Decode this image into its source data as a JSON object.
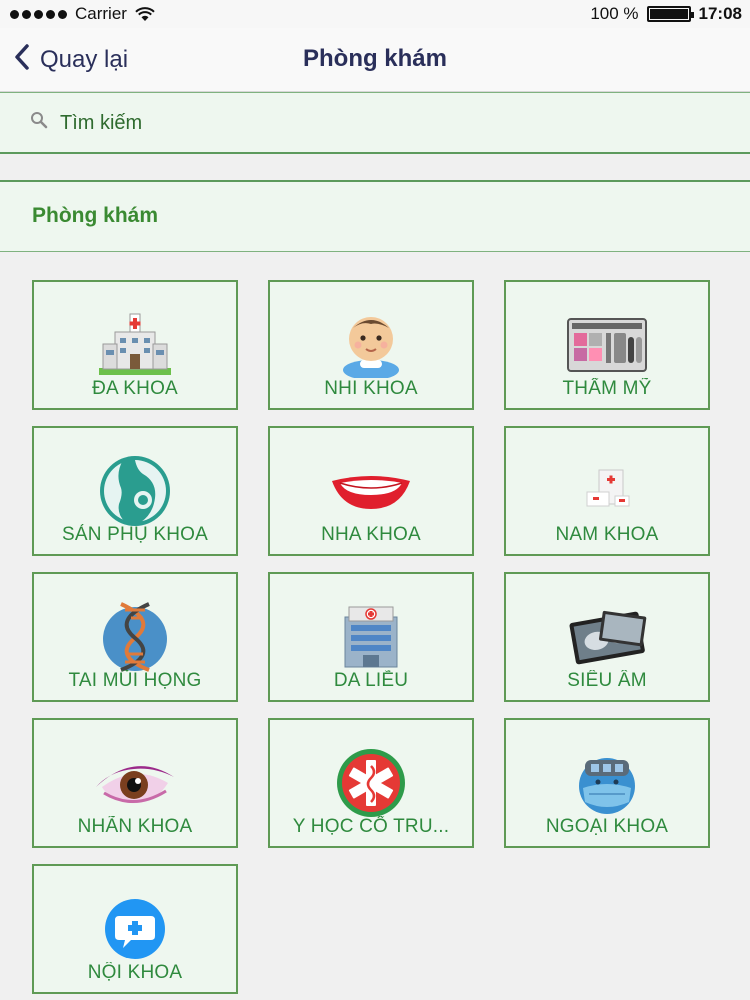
{
  "status_bar": {
    "carrier": "Carrier",
    "battery": "100 %",
    "battery_level": 1.0,
    "time": "17:08"
  },
  "nav": {
    "back_label": "Quay lại",
    "title": "Phòng khám"
  },
  "search": {
    "placeholder": "Tìm kiếm"
  },
  "section": {
    "title": "Phòng khám"
  },
  "colors": {
    "tile_background": "#eef7ef",
    "tile_border": "#5f9a55",
    "label_green": "#2f8a3e",
    "nav_text": "#2a2f5a"
  },
  "tiles": [
    {
      "label": "ĐA KHOA",
      "icon": "hospital-icon"
    },
    {
      "label": "NHI KHOA",
      "icon": "baby-icon"
    },
    {
      "label": "THẨM MỸ",
      "icon": "cosmetics-palette-icon"
    },
    {
      "label": "SẢN PHỤ KHOA",
      "icon": "pregnancy-icon"
    },
    {
      "label": "NHA KHOA",
      "icon": "smile-teeth-icon"
    },
    {
      "label": "NAM KHOA",
      "icon": "medicine-box-icon"
    },
    {
      "label": "TAI MŨI HỌNG",
      "icon": "dna-icon"
    },
    {
      "label": "DA LIỄU",
      "icon": "clinic-building-icon"
    },
    {
      "label": "SIÊU ÂM",
      "icon": "xray-film-icon"
    },
    {
      "label": "NHÃN KHOA",
      "icon": "eye-icon"
    },
    {
      "label": "Y HỌC CỔ TRU...",
      "icon": "star-of-life-icon"
    },
    {
      "label": "NGOẠI KHOA",
      "icon": "surgeon-mask-icon"
    },
    {
      "label": "NỘI KHOA",
      "icon": "medical-chat-icon"
    }
  ]
}
